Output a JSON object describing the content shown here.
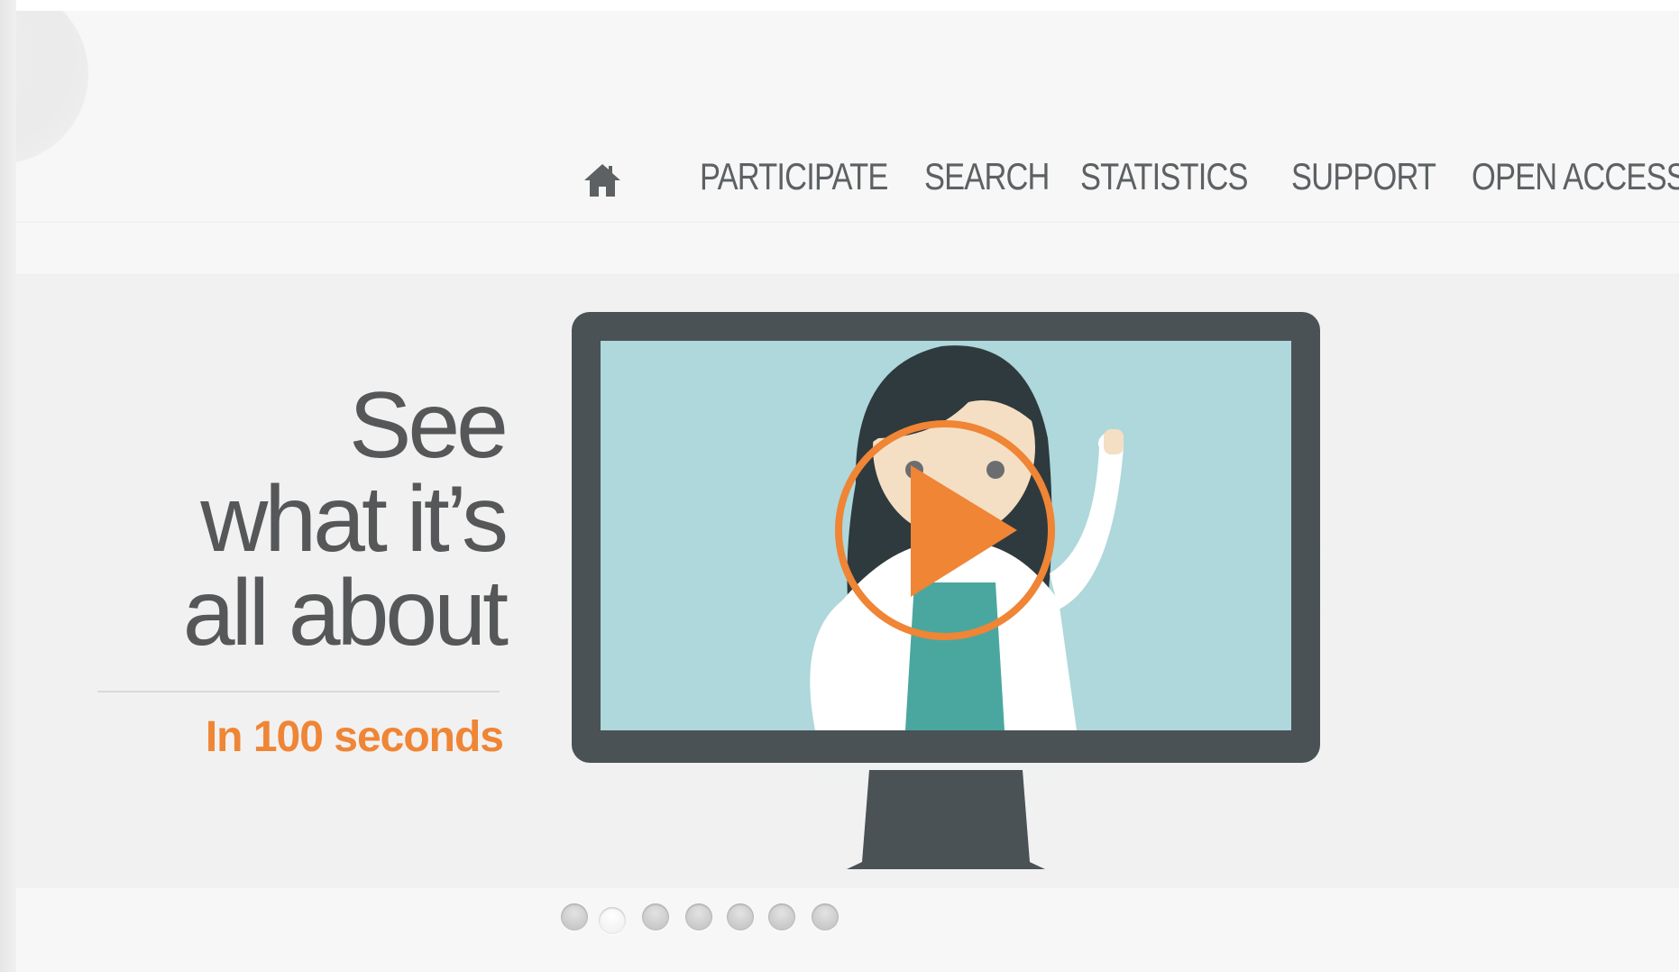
{
  "nav": {
    "home_icon": "home-icon",
    "items": [
      {
        "label": "PARTICIPATE"
      },
      {
        "label": "SEARCH"
      },
      {
        "label": "STATISTICS"
      },
      {
        "label": "SUPPORT"
      },
      {
        "label": "OPEN ACCESS"
      }
    ]
  },
  "hero": {
    "headline_lines": [
      "See",
      "what it’s",
      "all about"
    ],
    "subheadline": "In 100 seconds",
    "play_icon": "play-icon",
    "illustration": "monitor-with-doctor-illustration",
    "colors": {
      "accent": "#ef8535",
      "headline": "#555759",
      "monitor_frame": "#4a5256",
      "screen": "#aed8db"
    }
  },
  "slider": {
    "dot_count": 7,
    "active_index": 1
  }
}
